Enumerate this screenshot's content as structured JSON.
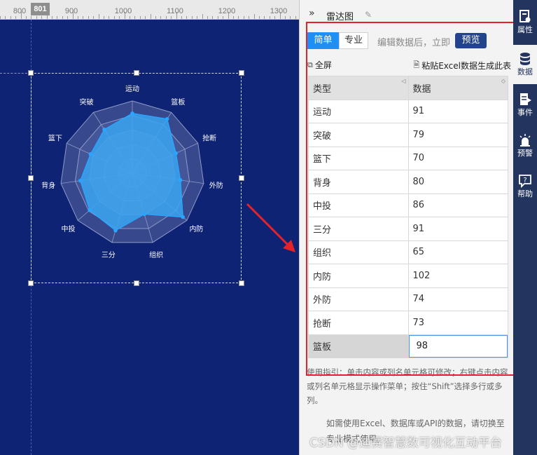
{
  "ruler": {
    "marker": "801",
    "labels": [
      "800",
      "900",
      "1000",
      "1100",
      "1200",
      "1300"
    ]
  },
  "panel": {
    "collapse_icon": "»",
    "title": "雷达图",
    "mode_simple": "简单",
    "mode_pro": "专业",
    "mode_hint": "编辑数据后，立即",
    "preview": "预览",
    "fullscreen": "全屏",
    "paste_excel": "粘贴Excel数据生成此表",
    "table_headers": [
      "类型",
      "数据"
    ],
    "rows": [
      {
        "type": "运动",
        "value": "91"
      },
      {
        "type": "突破",
        "value": "79"
      },
      {
        "type": "篮下",
        "value": "70"
      },
      {
        "type": "背身",
        "value": "80"
      },
      {
        "type": "中投",
        "value": "86"
      },
      {
        "type": "三分",
        "value": "91"
      },
      {
        "type": "组织",
        "value": "65"
      },
      {
        "type": "内防",
        "value": "102"
      },
      {
        "type": "外防",
        "value": "74"
      },
      {
        "type": "抢断",
        "value": "73"
      }
    ],
    "editing_row": {
      "type": "篮板",
      "value": "98"
    },
    "help_text": "使用指引：单击内容或列名单元格可修改；右键点击内容或列名单元格显示操作菜单；按住“Shift”选择多行或多列。",
    "help_text_2": "如需使用Excel、数据库或API的数据，请切换至专业模式使用。"
  },
  "watermark": "CSDN @迪赛智慧数可视化互动平台",
  "sidebar": {
    "items": [
      {
        "label": "属性",
        "icon": "properties-icon"
      },
      {
        "label": "数据",
        "icon": "database-icon"
      },
      {
        "label": "事件",
        "icon": "event-icon"
      },
      {
        "label": "预警",
        "icon": "alarm-icon"
      },
      {
        "label": "帮助",
        "icon": "help-icon"
      }
    ]
  },
  "colors": {
    "canvas_bg": "#0f2374",
    "radar_fill": "#3aa5f0",
    "radar_stroke": "#29a4ff",
    "grid": "#8f9ac8",
    "accent": "#1e8ff5",
    "highlight": "#e5222a",
    "sidebar_bg": "#23345f"
  },
  "chart_data": {
    "type": "radar",
    "indicators": [
      "运动",
      "篮板",
      "抢断",
      "外防",
      "内防",
      "组织",
      "三分",
      "中投",
      "背身",
      "篮下",
      "突破"
    ],
    "values": [
      91,
      98,
      73,
      74,
      102,
      65,
      91,
      86,
      80,
      70,
      79
    ],
    "max": 110,
    "rings": 5
  }
}
